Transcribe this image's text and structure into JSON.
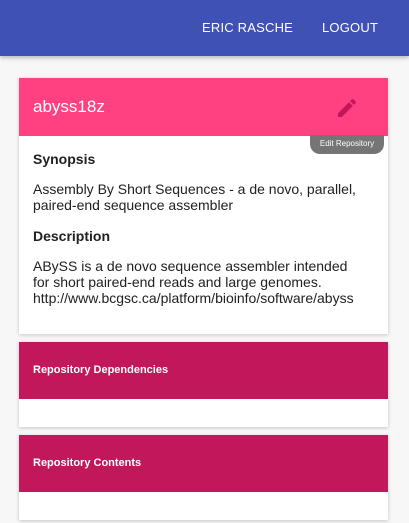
{
  "topbar": {
    "user_label": "ERIC RASCHE",
    "logout_label": "LOGOUT",
    "color": "#3f51b5"
  },
  "repository": {
    "name": "abyss18z",
    "header_color": "#ff4081",
    "edit_icon": "pencil-icon",
    "edit_tooltip": "Edit Repository",
    "synopsis_heading": "Synopsis",
    "synopsis": "Assembly By Short Sequences - a de novo, parallel, paired-end sequence assembler",
    "description_heading": "Description",
    "description_lines": [
      "ABySS is a de novo sequence assembler intended",
      "for short paired-end reads and large genomes.",
      "http://www.bcgsc.ca/platform/bioinfo/software/abyss"
    ]
  },
  "dependencies": {
    "title": "Repository Dependencies",
    "header_color": "#c2185b"
  },
  "contents": {
    "title": "Repository Contents",
    "header_color": "#c2185b"
  }
}
